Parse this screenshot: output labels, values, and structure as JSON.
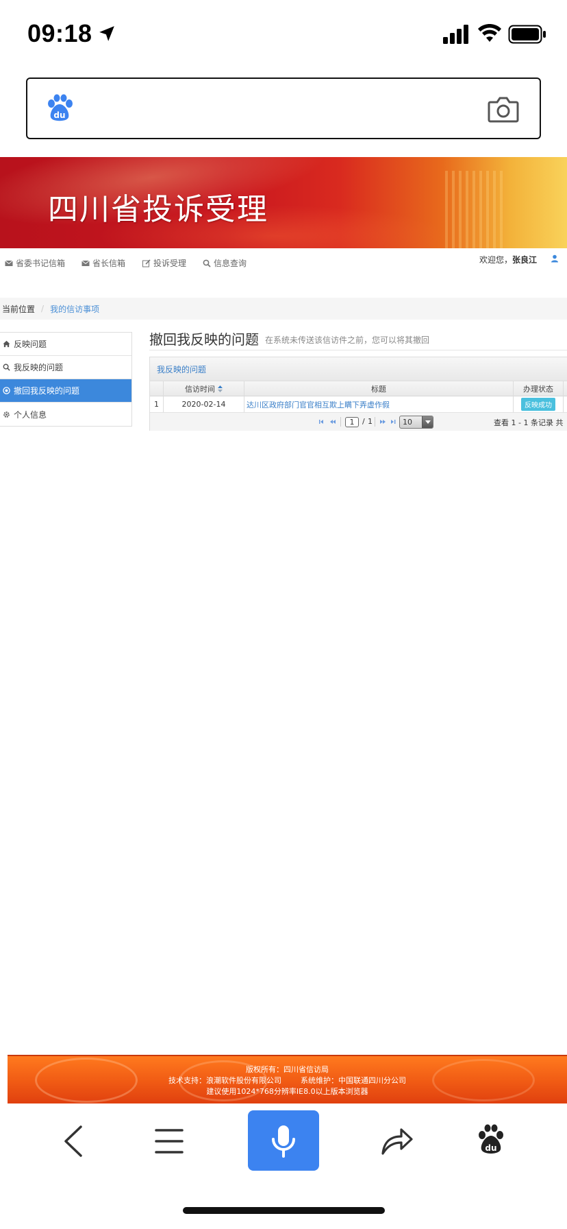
{
  "status_bar": {
    "time": "09:18"
  },
  "banner": {
    "title": "四川省投诉受理"
  },
  "top_nav": {
    "items": [
      {
        "icon": "envelope-icon",
        "label": "省委书记信箱"
      },
      {
        "icon": "envelope-icon",
        "label": "省长信箱"
      },
      {
        "icon": "edit-icon",
        "label": "投诉受理"
      },
      {
        "icon": "search-icon",
        "label": "信息查询"
      }
    ],
    "welcome_label": "欢迎您，",
    "user_name": "张良江"
  },
  "breadcrumb": {
    "label": "当前位置",
    "separator": "/",
    "current": "我的信访事项"
  },
  "sidebar": {
    "items": [
      {
        "icon": "home-icon",
        "label": "反映问题",
        "active": false
      },
      {
        "icon": "search-icon",
        "label": "我反映的问题",
        "active": false
      },
      {
        "icon": "circle-arrow-icon",
        "label": "撤回我反映的问题",
        "active": true
      },
      {
        "icon": "gear-icon",
        "label": "个人信息",
        "active": false
      }
    ]
  },
  "content": {
    "title": "撤回我反映的问题",
    "subtitle": "在系统未传送该信访件之前，您可以将其撤回",
    "panel_title": "我反映的问题",
    "table": {
      "columns": [
        "信访时间",
        "标题",
        "办理状态"
      ],
      "rows": [
        {
          "index": "1",
          "date": "2020-02-14",
          "title": "达川区政府部门官官相互欺上瞒下弄虚作假",
          "status": "反映成功"
        }
      ]
    },
    "pager": {
      "current_page": "1",
      "slash": "/",
      "total_pages": "1",
      "page_size": "10",
      "records_text": "查看 1 - 1 条记录   共"
    }
  },
  "footer": {
    "line1": "版权所有：四川省信访局",
    "line2": "技术支持：浪潮软件股份有限公司        系统维护：中国联通四川分公司",
    "line3": "建议使用1024*768分辨率IE8.0以上版本浏览器"
  },
  "colors": {
    "accent": "#3c88dc",
    "link": "#3a7fc8",
    "badge": "#4ac0de",
    "voice_button": "#3c83f0"
  }
}
